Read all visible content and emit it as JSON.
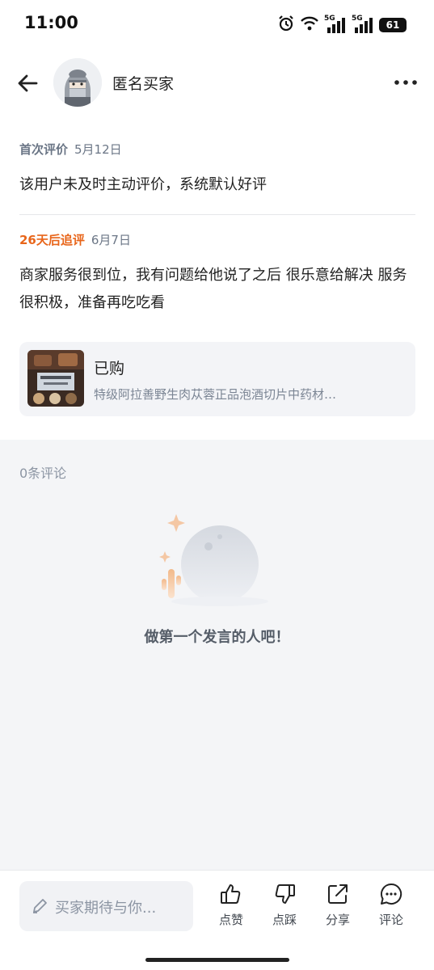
{
  "status_bar": {
    "time": "11:00",
    "network_1": "5G",
    "network_2": "5G",
    "battery": "61",
    "icons": [
      "alarm-icon",
      "wifi-icon",
      "signal-icon",
      "signal-icon",
      "battery-icon"
    ]
  },
  "header": {
    "user_name": "匿名买家",
    "back_icon": "back-arrow-icon",
    "more_icon": "more-icon"
  },
  "review": {
    "first_tag": "首次评价",
    "first_date": "5月12日",
    "first_text": "该用户未及时主动评价，系统默认好评",
    "follow_tag": "26天后追评",
    "follow_date": "6月7日",
    "follow_text": "商家服务很到位，我有问题给他说了之后 很乐意给解决 服务很积极，准备再吃吃看"
  },
  "product": {
    "bought_label": "已购",
    "title": "特级阿拉善野生肉苁蓉正品泡酒切片中药材…"
  },
  "comments": {
    "count_label": "0条评论",
    "empty_text": "做第一个发言的人吧！"
  },
  "bottom_bar": {
    "input_placeholder": "买家期待与你...",
    "like_label": "点赞",
    "dislike_label": "点踩",
    "share_label": "分享",
    "comment_label": "评论"
  },
  "colors": {
    "accent_orange": "#e8651a",
    "muted_text": "#6b7686",
    "background": "#f4f5f7"
  }
}
